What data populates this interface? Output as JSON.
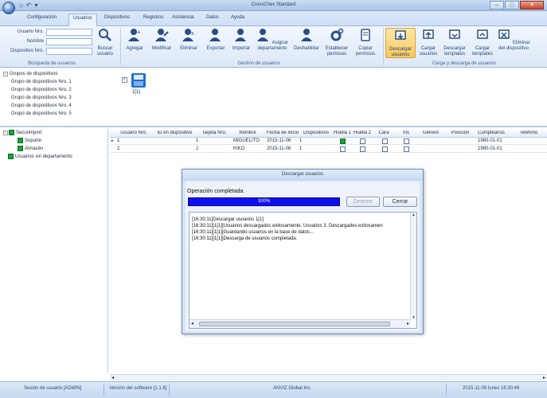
{
  "window": {
    "title": "CrossChex Standard",
    "quick_access": [
      "⌂",
      "↶",
      "▾"
    ],
    "controls": [
      "–",
      "□",
      "✕"
    ]
  },
  "tabs": [
    "Configuración",
    "Usuarios",
    "Dispositivos",
    "Registros",
    "Asistencia",
    "Datos",
    "Ayuda"
  ],
  "active_tab": "Usuarios",
  "search": {
    "group_label": "Búsqueda de usuarios",
    "fields": [
      {
        "label": "Usuario Nro.",
        "value": ""
      },
      {
        "label": "Nombre",
        "value": ""
      },
      {
        "label": "Dispositivo Nro.",
        "value": ""
      }
    ],
    "button": "Buscar usuario"
  },
  "user_mgmt": {
    "group_label": "Gestión de usuarios",
    "buttons": [
      "Agregar",
      "Modificar",
      "Eliminar",
      "Exportar",
      "Importar",
      "Asignar departamento",
      "Deshabilitar",
      "Establecer permisos",
      "Copiar permisos"
    ]
  },
  "upload_download": {
    "group_label": "Carga y descarga de usuarios",
    "buttons": [
      "Descargar usuarios",
      "Cargar usuarios",
      "Descargar templates",
      "Cargar templates",
      "Eliminar del dispositivo"
    ]
  },
  "device_groups": {
    "root": "Grupos de dispositivos",
    "items": [
      "Grupo de dispositivos Nro. 1",
      "Grupo de dispositivos Nro. 2",
      "Grupo de dispositivos Nro. 3",
      "Grupo de dispositivos Nro. 4",
      "Grupo de dispositivos Nro. 5"
    ]
  },
  "device": {
    "label": "1[1]",
    "checked": true
  },
  "departments": {
    "root": "Securimport",
    "children": [
      "Soporte",
      "Almacén"
    ],
    "other": "Usuarios sin departamento"
  },
  "users_table": {
    "columns": [
      "Usuario Nro.",
      "ID en dispositivo",
      "Tarjeta Nro.",
      "Nombre",
      "Fecha de inicio",
      "Dispositivos",
      "Huella 1",
      "Huella 2",
      "Cara",
      "Iris",
      "Género",
      "Posición",
      "Cumpleaños",
      "Teléfono"
    ],
    "rows": [
      {
        "user_no": "1",
        "device_id": "1",
        "card": "",
        "name": "MIGUELITO",
        "start_date": "2015-11-06",
        "devices": "1",
        "fp1": true,
        "fp2": false,
        "face": false,
        "iris": false,
        "gender": "",
        "position": "",
        "birthday": "1980-01-01",
        "phone": ""
      },
      {
        "user_no": "2",
        "device_id": "2",
        "card": "",
        "name": "KIKO",
        "start_date": "2015-11-06",
        "devices": "1",
        "fp1": false,
        "fp2": false,
        "face": false,
        "iris": false,
        "gender": "",
        "position": "",
        "birthday": "1980-01-01",
        "phone": ""
      }
    ]
  },
  "dialog": {
    "title": "Descargar usuarios",
    "status": "Operación completada.",
    "progress_text": "100%",
    "progress": 1.0,
    "stop_button": "Detener",
    "close_button": "Cerrar",
    "log": [
      "[16:30:11]Descargar usuarios 1[1]",
      "[16:30:11][1[1]]Usuarios descargados exitosamente. Usuarios 3. Descargados exitosamen",
      "[16:30:11][1[1]]Guardando usuarios en la base de datos...",
      "[16:30:11][1[1]]Descarga de usuarios completada."
    ]
  },
  "statusbar": {
    "session": "Sesión de usuario  [ADMIN]",
    "version": "Versión del software  [1.1.6]",
    "company": "ANVIZ Global Inc.",
    "datetime": "2015-11-09 lunes 16:30:49"
  }
}
